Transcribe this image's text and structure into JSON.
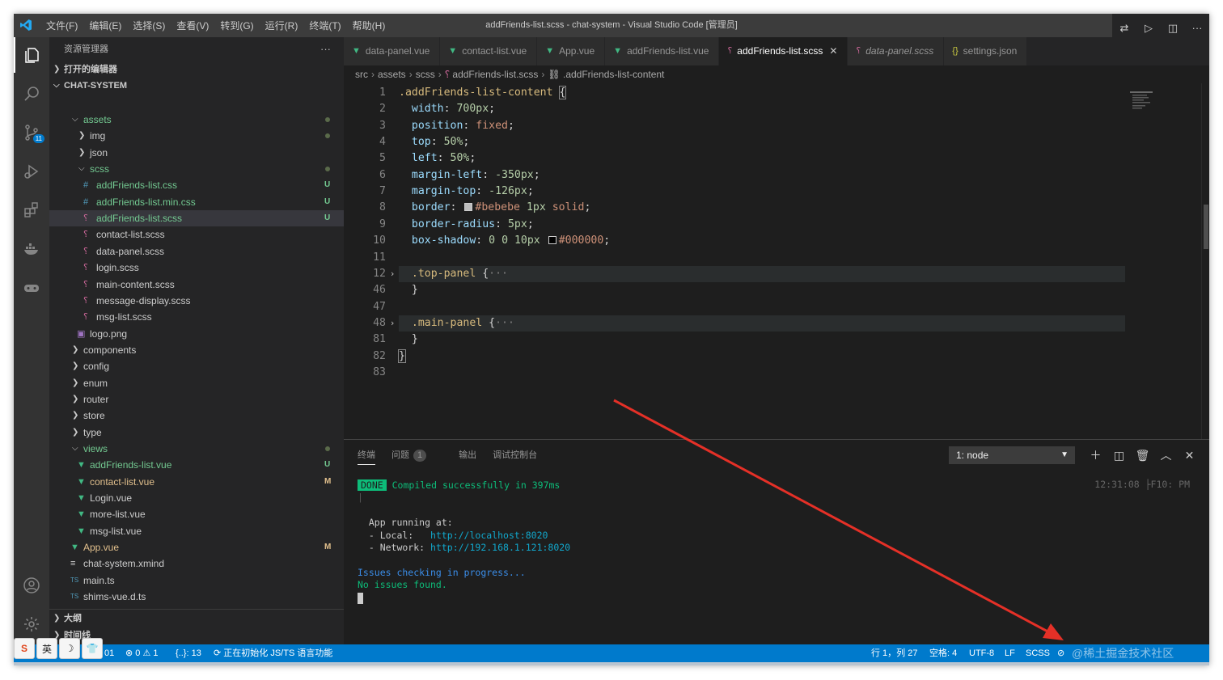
{
  "window": {
    "title": "addFriends-list.scss - chat-system - Visual Studio Code [管理员]",
    "menus": [
      "文件(F)",
      "编辑(E)",
      "选择(S)",
      "查看(V)",
      "转到(G)",
      "运行(R)",
      "终端(T)",
      "帮助(H)"
    ]
  },
  "activity_bar": {
    "items": [
      {
        "name": "explorer-icon"
      },
      {
        "name": "search-icon"
      },
      {
        "name": "source-control-icon",
        "badge": "11"
      },
      {
        "name": "run-debug-icon"
      },
      {
        "name": "extensions-icon"
      },
      {
        "name": "docker-icon"
      },
      {
        "name": "remote-gamepad-icon"
      }
    ],
    "bottom": [
      {
        "name": "account-icon"
      },
      {
        "name": "settings-gear-icon"
      }
    ]
  },
  "sidebar": {
    "title": "资源管理器",
    "more": "···",
    "open_editors": "打开的编辑器",
    "project": "CHAT-SYSTEM",
    "tree": [
      {
        "label": "assets",
        "depth": 1,
        "type": "folder-open",
        "color": "#73c991",
        "dot": true
      },
      {
        "label": "img",
        "depth": 2,
        "type": "folder",
        "color": "#cccccc",
        "dot": true
      },
      {
        "label": "json",
        "depth": 2,
        "type": "folder",
        "color": "#cccccc"
      },
      {
        "label": "scss",
        "depth": 2,
        "type": "folder-open",
        "color": "#73c991",
        "dot": true
      },
      {
        "label": "addFriends-list.css",
        "depth": 3,
        "type": "css",
        "color": "#73c991",
        "status": "U"
      },
      {
        "label": "addFriends-list.min.css",
        "depth": 3,
        "type": "css",
        "color": "#73c991",
        "status": "U"
      },
      {
        "label": "addFriends-list.scss",
        "depth": 3,
        "type": "scss",
        "color": "#73c991",
        "status": "U",
        "selected": true
      },
      {
        "label": "contact-list.scss",
        "depth": 3,
        "type": "scss",
        "color": "#cccccc"
      },
      {
        "label": "data-panel.scss",
        "depth": 3,
        "type": "scss",
        "color": "#cccccc"
      },
      {
        "label": "login.scss",
        "depth": 3,
        "type": "scss",
        "color": "#cccccc"
      },
      {
        "label": "main-content.scss",
        "depth": 3,
        "type": "scss",
        "color": "#cccccc"
      },
      {
        "label": "message-display.scss",
        "depth": 3,
        "type": "scss",
        "color": "#cccccc"
      },
      {
        "label": "msg-list.scss",
        "depth": 3,
        "type": "scss",
        "color": "#cccccc"
      },
      {
        "label": "logo.png",
        "depth": 2,
        "type": "image",
        "color": "#cccccc"
      },
      {
        "label": "components",
        "depth": 1,
        "type": "folder",
        "color": "#cccccc"
      },
      {
        "label": "config",
        "depth": 1,
        "type": "folder",
        "color": "#cccccc"
      },
      {
        "label": "enum",
        "depth": 1,
        "type": "folder",
        "color": "#cccccc"
      },
      {
        "label": "router",
        "depth": 1,
        "type": "folder",
        "color": "#cccccc"
      },
      {
        "label": "store",
        "depth": 1,
        "type": "folder",
        "color": "#cccccc"
      },
      {
        "label": "type",
        "depth": 1,
        "type": "folder",
        "color": "#cccccc"
      },
      {
        "label": "views",
        "depth": 1,
        "type": "folder-open",
        "color": "#73c991",
        "dot": true
      },
      {
        "label": "addFriends-list.vue",
        "depth": 2,
        "type": "vue",
        "color": "#73c991",
        "status": "U"
      },
      {
        "label": "contact-list.vue",
        "depth": 2,
        "type": "vue",
        "color": "#e2c08d",
        "status": "M"
      },
      {
        "label": "Login.vue",
        "depth": 2,
        "type": "vue",
        "color": "#cccccc"
      },
      {
        "label": "more-list.vue",
        "depth": 2,
        "type": "vue",
        "color": "#cccccc"
      },
      {
        "label": "msg-list.vue",
        "depth": 2,
        "type": "vue",
        "color": "#cccccc"
      },
      {
        "label": "App.vue",
        "depth": 1,
        "type": "vue",
        "color": "#e2c08d",
        "status": "M"
      },
      {
        "label": "chat-system.xmind",
        "depth": 1,
        "type": "file",
        "color": "#cccccc"
      },
      {
        "label": "main.ts",
        "depth": 1,
        "type": "ts",
        "color": "#cccccc"
      },
      {
        "label": "shims-vue.d.ts",
        "depth": 1,
        "type": "ts",
        "color": "#cccccc"
      }
    ],
    "outline": "大纲",
    "timeline": "时间线",
    "npm": "NPM 脚本"
  },
  "tabs": [
    {
      "label": "data-panel.vue",
      "icon": "vue"
    },
    {
      "label": "contact-list.vue",
      "icon": "vue"
    },
    {
      "label": "App.vue",
      "icon": "vue"
    },
    {
      "label": "addFriends-list.vue",
      "icon": "vue"
    },
    {
      "label": "addFriends-list.scss",
      "icon": "scss",
      "active": true,
      "close": "✕"
    },
    {
      "label": "data-panel.scss",
      "icon": "scss",
      "italic": true
    },
    {
      "label": "settings.json",
      "icon": "json"
    }
  ],
  "breadcrumb": [
    "src",
    "assets",
    "scss",
    "addFriends-list.scss",
    ".addFriends-list-content"
  ],
  "editor": {
    "lines": [
      {
        "n": "1",
        "segs": [
          [
            "sel",
            ".addFriends-list-content "
          ],
          [
            "brace",
            "{"
          ]
        ]
      },
      {
        "n": "2",
        "segs": [
          [
            "prop",
            "  width"
          ],
          [
            "txt",
            ": "
          ],
          [
            "num",
            "700px"
          ],
          [
            "txt",
            ";"
          ]
        ]
      },
      {
        "n": "3",
        "segs": [
          [
            "prop",
            "  position"
          ],
          [
            "txt",
            ": "
          ],
          [
            "val",
            "fixed"
          ],
          [
            "txt",
            ";"
          ]
        ]
      },
      {
        "n": "4",
        "segs": [
          [
            "prop",
            "  top"
          ],
          [
            "txt",
            ": "
          ],
          [
            "num",
            "50%"
          ],
          [
            "txt",
            ";"
          ]
        ]
      },
      {
        "n": "5",
        "segs": [
          [
            "prop",
            "  left"
          ],
          [
            "txt",
            ": "
          ],
          [
            "num",
            "50%"
          ],
          [
            "txt",
            ";"
          ]
        ]
      },
      {
        "n": "6",
        "segs": [
          [
            "prop",
            "  margin-left"
          ],
          [
            "txt",
            ": "
          ],
          [
            "num",
            "-350px"
          ],
          [
            "txt",
            ";"
          ]
        ]
      },
      {
        "n": "7",
        "segs": [
          [
            "prop",
            "  margin-top"
          ],
          [
            "txt",
            ": "
          ],
          [
            "num",
            "-126px"
          ],
          [
            "txt",
            ";"
          ]
        ]
      },
      {
        "n": "8",
        "segs": [
          [
            "prop",
            "  border"
          ],
          [
            "txt",
            ": "
          ],
          [
            "swatch",
            "#bebebe"
          ],
          [
            "val",
            "#bebebe"
          ],
          [
            "txt",
            " "
          ],
          [
            "num",
            "1px"
          ],
          [
            "txt",
            " "
          ],
          [
            "val",
            "solid"
          ],
          [
            "txt",
            ";"
          ]
        ]
      },
      {
        "n": "9",
        "segs": [
          [
            "prop",
            "  border-radius"
          ],
          [
            "txt",
            ": "
          ],
          [
            "num",
            "5px"
          ],
          [
            "txt",
            ";"
          ]
        ]
      },
      {
        "n": "10",
        "segs": [
          [
            "prop",
            "  box-shadow"
          ],
          [
            "txt",
            ": "
          ],
          [
            "num",
            "0"
          ],
          [
            "txt",
            " "
          ],
          [
            "num",
            "0"
          ],
          [
            "txt",
            " "
          ],
          [
            "num",
            "10px"
          ],
          [
            "txt",
            " "
          ],
          [
            "swatch",
            "#000000"
          ],
          [
            "val",
            "#000000"
          ],
          [
            "txt",
            ";"
          ]
        ]
      },
      {
        "n": "11",
        "segs": []
      },
      {
        "n": "12",
        "fold": true,
        "hl": true,
        "segs": [
          [
            "sel",
            "  .top-panel "
          ],
          [
            "txt",
            "{"
          ],
          [
            "fold",
            "···"
          ]
        ]
      },
      {
        "n": "46",
        "segs": [
          [
            "txt",
            "  }"
          ]
        ]
      },
      {
        "n": "47",
        "segs": []
      },
      {
        "n": "48",
        "fold": true,
        "hl": true,
        "segs": [
          [
            "sel",
            "  .main-panel "
          ],
          [
            "txt",
            "{"
          ],
          [
            "fold",
            "···"
          ]
        ]
      },
      {
        "n": "81",
        "segs": [
          [
            "txt",
            "  }"
          ]
        ]
      },
      {
        "n": "82",
        "segs": [
          [
            "brace",
            "}"
          ]
        ]
      },
      {
        "n": "83",
        "segs": []
      }
    ]
  },
  "panel": {
    "tabs": [
      {
        "label": "终端",
        "active": true
      },
      {
        "label": "问题",
        "badge": "1"
      },
      {
        "label": "输出"
      },
      {
        "label": "调试控制台"
      }
    ],
    "terminal_select": "1: node",
    "time": "12:31:08 ├F10: PM",
    "lines": [
      {
        "segs": [
          [
            "done",
            "DONE"
          ],
          [
            "green",
            " Compiled successfully in 397ms"
          ]
        ]
      },
      {
        "segs": [
          [
            "dim",
            "|"
          ]
        ]
      },
      {
        "segs": []
      },
      {
        "segs": [
          [
            "txt",
            "  App running at:"
          ]
        ]
      },
      {
        "segs": [
          [
            "txt",
            "  - Local:   "
          ],
          [
            "cyan",
            "http://localhost:8020"
          ]
        ]
      },
      {
        "segs": [
          [
            "txt",
            "  - Network: "
          ],
          [
            "cyan",
            "http://192.168.1.121:8020"
          ]
        ]
      },
      {
        "segs": []
      },
      {
        "segs": [
          [
            "blue",
            "Issues checking in progress..."
          ]
        ]
      },
      {
        "segs": [
          [
            "green",
            "No issues found."
          ]
        ]
      }
    ]
  },
  "statusbar": {
    "branch_suffix": "01",
    "errors": "⊗ 0 ⚠ 1",
    "selection": "{..}: 13",
    "init": "⟳ 正在初始化 JS/TS 语言功能",
    "position": "行 1，列 27",
    "spaces": "空格: 4",
    "encoding": "UTF-8",
    "eol": "LF",
    "language": "SCSS",
    "watermark": "@稀土掘金技术社区"
  },
  "ime": [
    "S",
    "英",
    "☽",
    "👕"
  ]
}
